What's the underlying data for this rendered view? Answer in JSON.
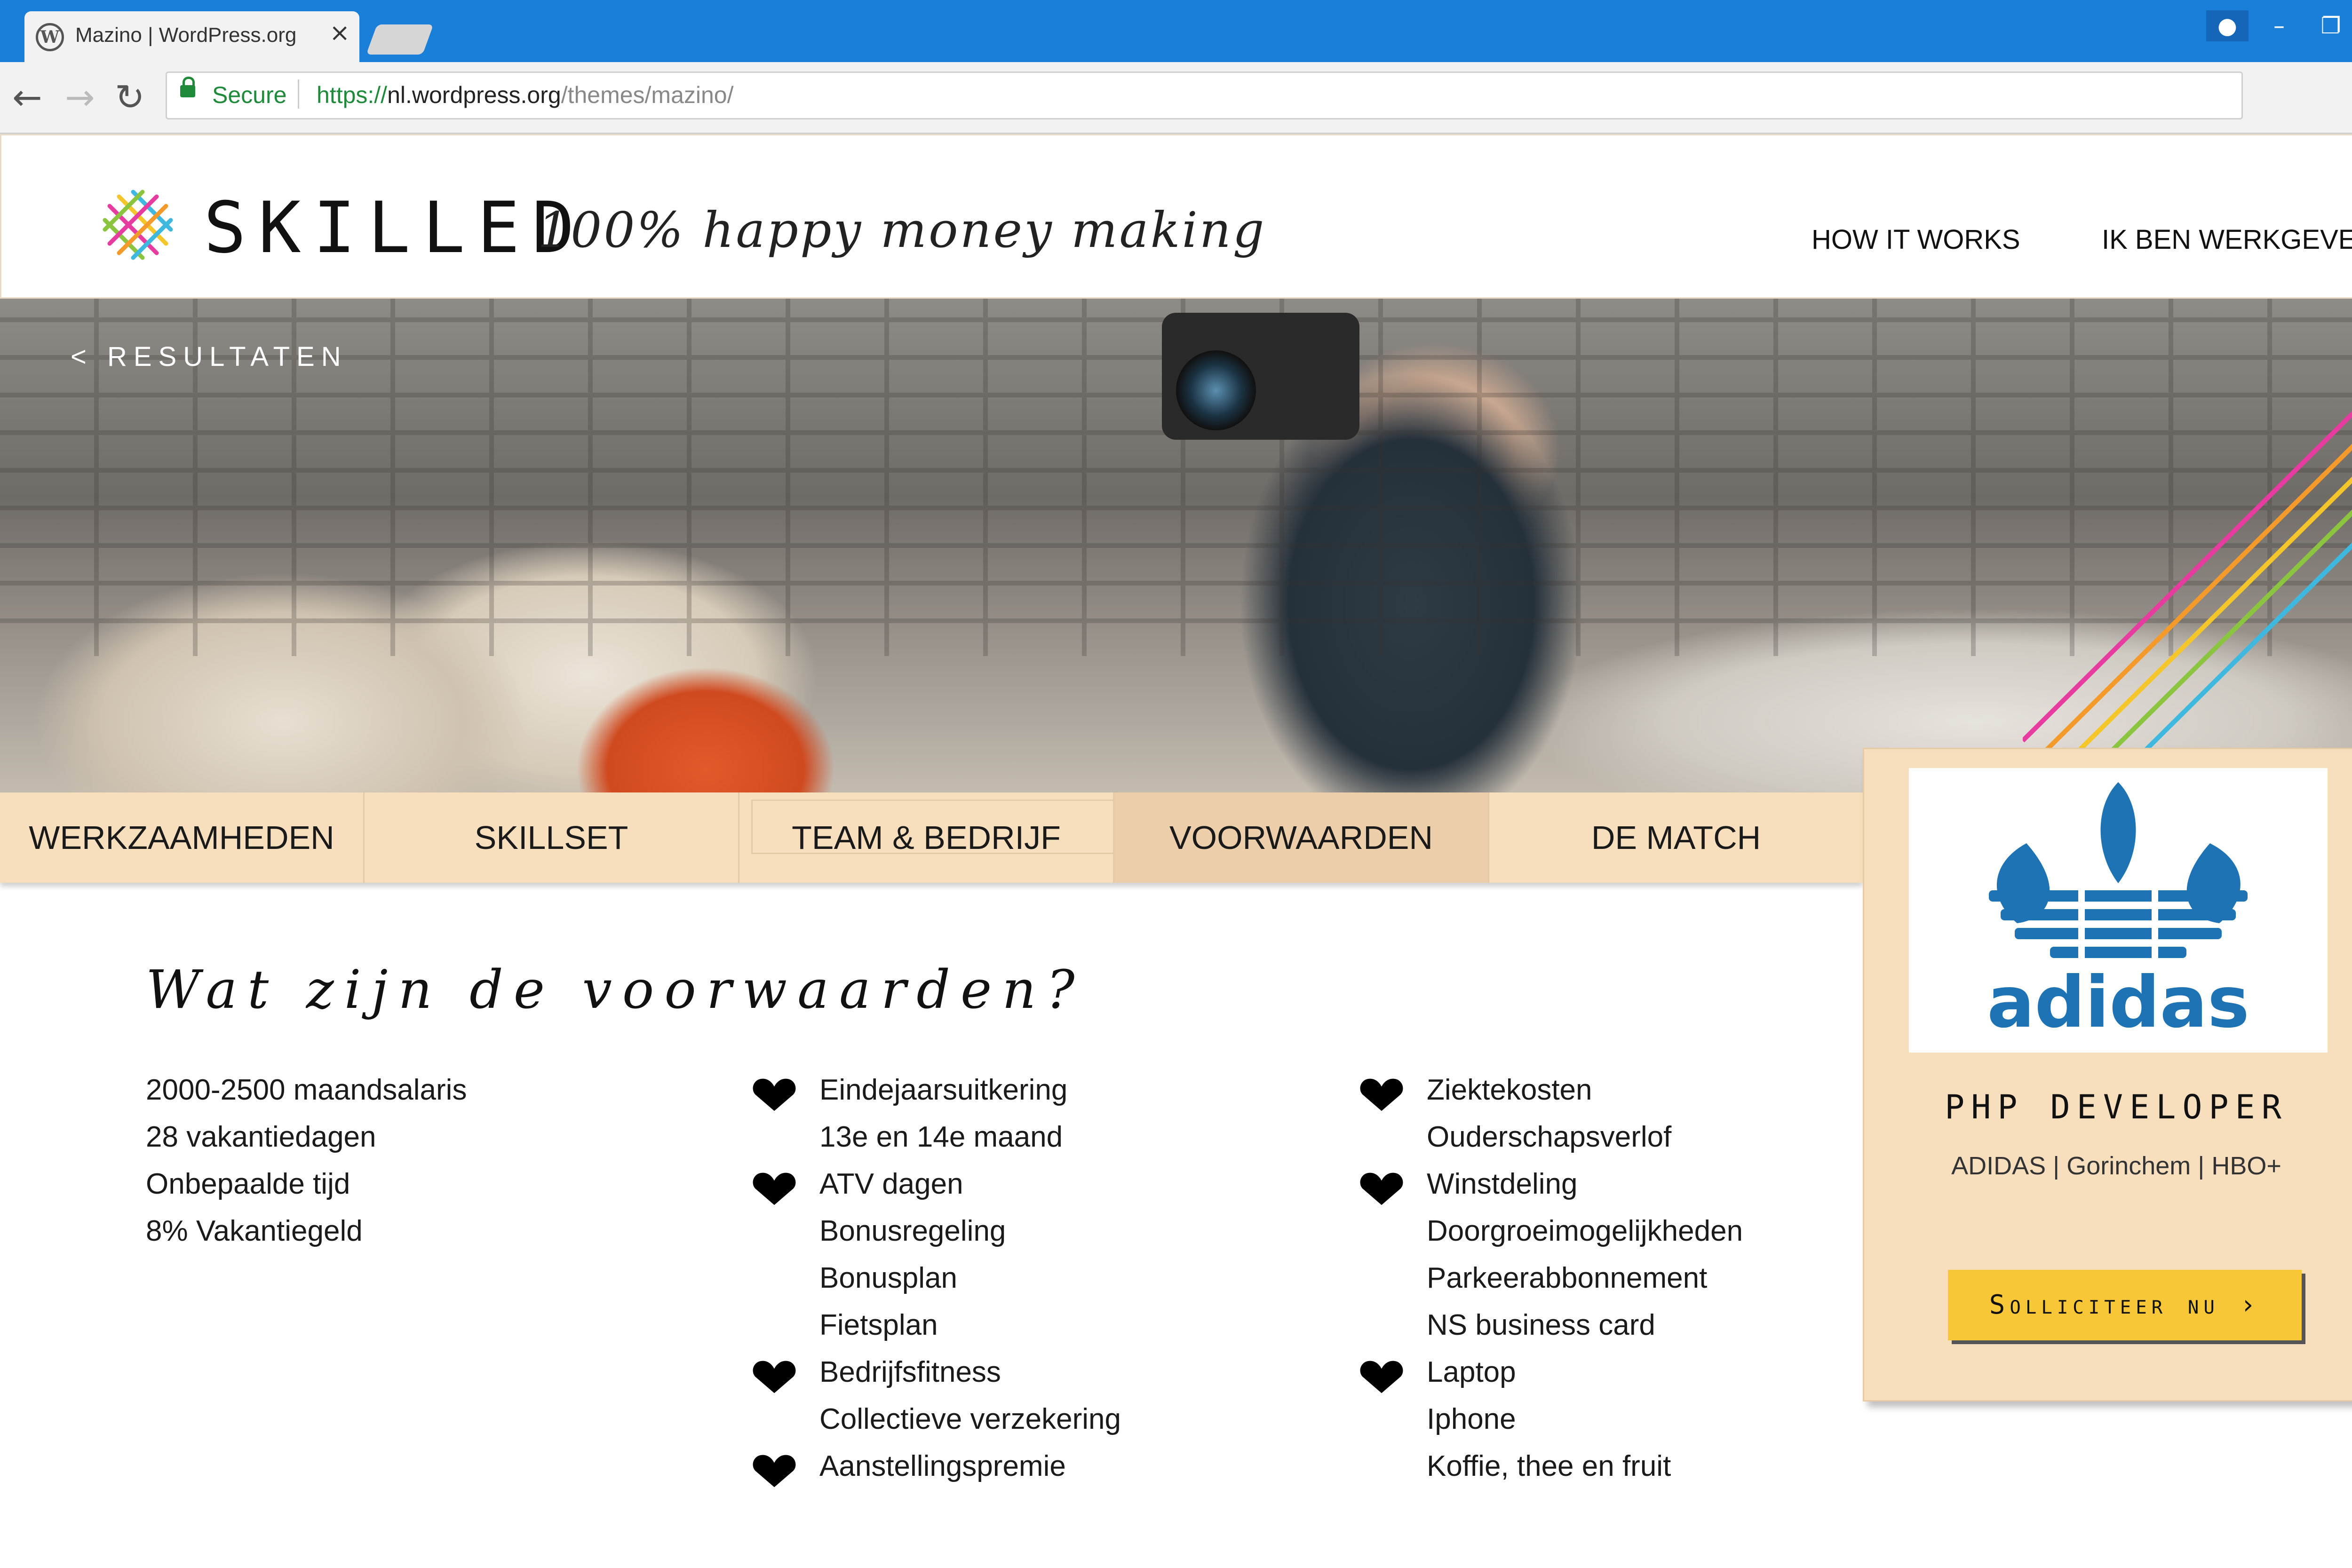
{
  "browser": {
    "tab_title": "Mazino | WordPress.org",
    "tab_close": "×",
    "secure_label": "Secure",
    "url_scheme": "https://",
    "url_host": "nl.wordpress.org",
    "url_path": "/themes/mazino/"
  },
  "site": {
    "logo_text": "SKILLED",
    "tagline": "100% happy money making",
    "nav": [
      "HOW IT WORKS",
      "IK BEN WERKGEVER"
    ]
  },
  "hero": {
    "back_link": "< RESULTATEN"
  },
  "tabs": [
    "WERKZAAMHEDEN",
    "SKILLSET",
    "TEAM & BEDRIJF",
    "VOORWAARDEN",
    "DE MATCH"
  ],
  "active_tab": "VOORWAARDEN",
  "content": {
    "heading": "Wat zijn de voorwaarden?",
    "col1": [
      "2000-2500 maandsalaris",
      "28 vakantiedagen",
      "Onbepaalde tijd",
      "8% Vakantiegeld"
    ],
    "col2": [
      "Eindejaarsuitkering",
      "13e en 14e maand",
      "ATV dagen",
      "Bonusregeling",
      "Bonusplan",
      "Fietsplan",
      "Bedrijfsfitness",
      "Collectieve verzekering",
      "Aanstellingspremie"
    ],
    "col3": [
      "Ziektekosten",
      "Ouderschapsverlof",
      "Winstdeling",
      "Doorgroeimogelijkheden",
      "Parkeerabbonnement",
      "NS business card",
      "Laptop",
      "Iphone",
      "Koffie, thee en fruit"
    ]
  },
  "card": {
    "company_logo": "adidas",
    "job_title": "PHP DEVELOPER",
    "meta": "ADIDAS | Gorinchem | HBO+",
    "apply_label": "Solliciteer nu",
    "apply_icon": "chevron-right-icon"
  },
  "colors": {
    "tab_bg": "#f7dfbe",
    "active_tab_bg": "#eccfaa",
    "apply_button": "#f8c737",
    "adidas_blue": "#1e73b4",
    "titlebar": "#1a7fd8"
  }
}
